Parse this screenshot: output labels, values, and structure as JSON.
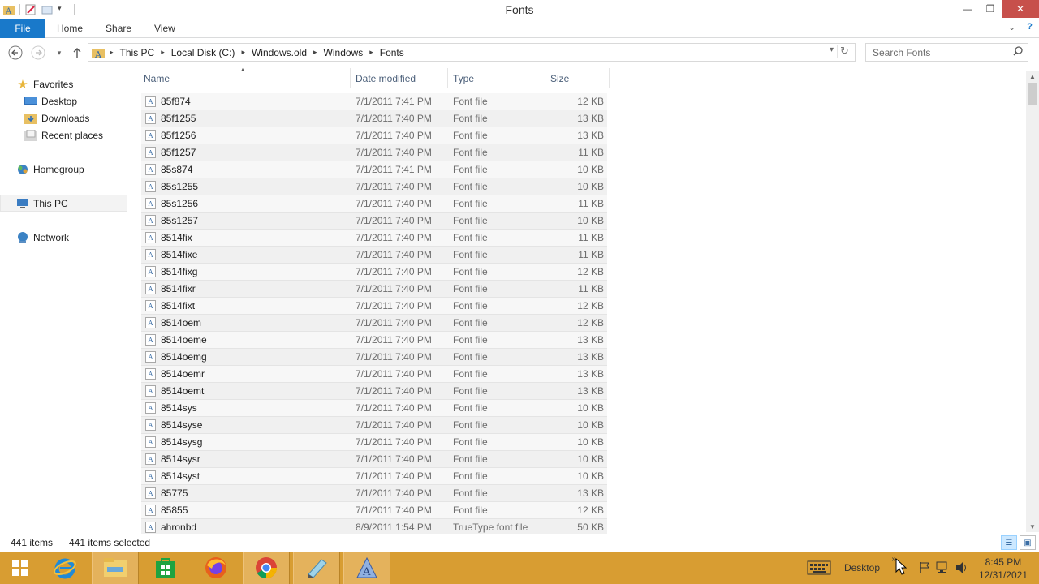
{
  "window": {
    "title": "Fonts"
  },
  "ribbon": {
    "file_tab": "File",
    "tabs": [
      "Home",
      "Share",
      "View"
    ]
  },
  "address": {
    "breadcrumbs": [
      "This PC",
      "Local Disk (C:)",
      "Windows.old",
      "Windows",
      "Fonts"
    ],
    "search_placeholder": "Search Fonts"
  },
  "navigation": {
    "favorites": "Favorites",
    "desktop": "Desktop",
    "downloads": "Downloads",
    "recent_places": "Recent places",
    "homegroup": "Homegroup",
    "this_pc": "This PC",
    "network": "Network"
  },
  "columns": {
    "name": "Name",
    "date_modified": "Date modified",
    "type": "Type",
    "size": "Size"
  },
  "files": [
    {
      "name": "85f874",
      "date": "7/1/2011 7:41 PM",
      "type": "Font file",
      "size": "12 KB"
    },
    {
      "name": "85f1255",
      "date": "7/1/2011 7:40 PM",
      "type": "Font file",
      "size": "13 KB"
    },
    {
      "name": "85f1256",
      "date": "7/1/2011 7:40 PM",
      "type": "Font file",
      "size": "13 KB"
    },
    {
      "name": "85f1257",
      "date": "7/1/2011 7:40 PM",
      "type": "Font file",
      "size": "11 KB"
    },
    {
      "name": "85s874",
      "date": "7/1/2011 7:41 PM",
      "type": "Font file",
      "size": "10 KB"
    },
    {
      "name": "85s1255",
      "date": "7/1/2011 7:40 PM",
      "type": "Font file",
      "size": "10 KB"
    },
    {
      "name": "85s1256",
      "date": "7/1/2011 7:40 PM",
      "type": "Font file",
      "size": "11 KB"
    },
    {
      "name": "85s1257",
      "date": "7/1/2011 7:40 PM",
      "type": "Font file",
      "size": "10 KB"
    },
    {
      "name": "8514fix",
      "date": "7/1/2011 7:40 PM",
      "type": "Font file",
      "size": "11 KB"
    },
    {
      "name": "8514fixe",
      "date": "7/1/2011 7:40 PM",
      "type": "Font file",
      "size": "11 KB"
    },
    {
      "name": "8514fixg",
      "date": "7/1/2011 7:40 PM",
      "type": "Font file",
      "size": "12 KB"
    },
    {
      "name": "8514fixr",
      "date": "7/1/2011 7:40 PM",
      "type": "Font file",
      "size": "11 KB"
    },
    {
      "name": "8514fixt",
      "date": "7/1/2011 7:40 PM",
      "type": "Font file",
      "size": "12 KB"
    },
    {
      "name": "8514oem",
      "date": "7/1/2011 7:40 PM",
      "type": "Font file",
      "size": "12 KB"
    },
    {
      "name": "8514oeme",
      "date": "7/1/2011 7:40 PM",
      "type": "Font file",
      "size": "13 KB"
    },
    {
      "name": "8514oemg",
      "date": "7/1/2011 7:40 PM",
      "type": "Font file",
      "size": "13 KB"
    },
    {
      "name": "8514oemr",
      "date": "7/1/2011 7:40 PM",
      "type": "Font file",
      "size": "13 KB"
    },
    {
      "name": "8514oemt",
      "date": "7/1/2011 7:40 PM",
      "type": "Font file",
      "size": "13 KB"
    },
    {
      "name": "8514sys",
      "date": "7/1/2011 7:40 PM",
      "type": "Font file",
      "size": "10 KB"
    },
    {
      "name": "8514syse",
      "date": "7/1/2011 7:40 PM",
      "type": "Font file",
      "size": "10 KB"
    },
    {
      "name": "8514sysg",
      "date": "7/1/2011 7:40 PM",
      "type": "Font file",
      "size": "10 KB"
    },
    {
      "name": "8514sysr",
      "date": "7/1/2011 7:40 PM",
      "type": "Font file",
      "size": "10 KB"
    },
    {
      "name": "8514syst",
      "date": "7/1/2011 7:40 PM",
      "type": "Font file",
      "size": "10 KB"
    },
    {
      "name": "85775",
      "date": "7/1/2011 7:40 PM",
      "type": "Font file",
      "size": "13 KB"
    },
    {
      "name": "85855",
      "date": "7/1/2011 7:40 PM",
      "type": "Font file",
      "size": "12 KB"
    },
    {
      "name": "ahronbd",
      "date": "8/9/2011 1:54 PM",
      "type": "TrueType font file",
      "size": "50 KB"
    }
  ],
  "status": {
    "item_count": "441 items",
    "selected_count": "441 items selected"
  },
  "taskbar": {
    "desktop_label": "Desktop",
    "time": "8:45 PM",
    "date": "12/31/2021"
  },
  "colors": {
    "file_tab": "#1979ca",
    "taskbar": "#d89d32",
    "close_button": "#c7504b"
  },
  "icons": {
    "file_row": "font-file-icon",
    "favorites": "star-icon",
    "desktop": "desktop-icon",
    "downloads": "downloads-folder-icon",
    "recent_places": "recent-places-icon",
    "homegroup": "homegroup-icon",
    "this_pc": "computer-icon",
    "network": "network-icon"
  }
}
